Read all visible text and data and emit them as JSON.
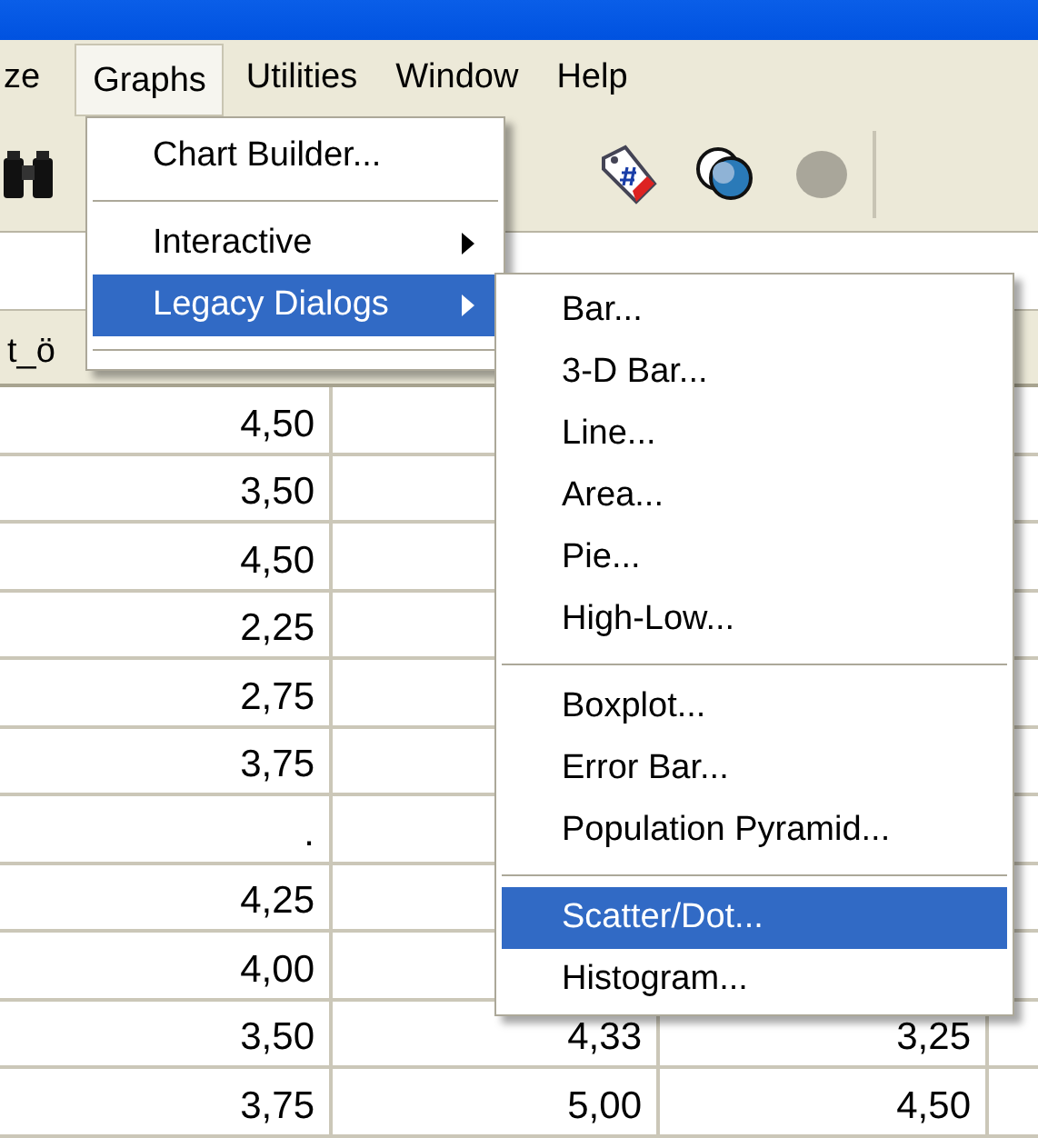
{
  "menubar": [
    {
      "label": "ze",
      "selected": false
    },
    {
      "label": "Graphs",
      "selected": true
    },
    {
      "label": "Utilities",
      "selected": false
    },
    {
      "label": "Window",
      "selected": false
    },
    {
      "label": "Help",
      "selected": false
    }
  ],
  "table": {
    "header": "t_ö",
    "rows": [
      {
        "cells": [
          "4,50"
        ]
      },
      {
        "cells": [
          "3,50"
        ]
      },
      {
        "cells": [
          "4,50"
        ]
      },
      {
        "cells": [
          "2,25"
        ]
      },
      {
        "cells": [
          "2,75"
        ]
      },
      {
        "cells": [
          "3,75"
        ]
      },
      {
        "cells": [
          "."
        ]
      },
      {
        "cells": [
          "4,25"
        ]
      },
      {
        "cells": [
          "4,00"
        ]
      },
      {
        "cells": [
          "3,50",
          "4,33",
          "3,25"
        ]
      },
      {
        "cells": [
          "3,75",
          "5,00",
          "4,50"
        ]
      }
    ]
  },
  "graphs_menu": [
    {
      "kind": "item",
      "label": "Chart Builder...",
      "selected": false,
      "submenu": false
    },
    {
      "kind": "separator"
    },
    {
      "kind": "item",
      "label": "Interactive",
      "selected": false,
      "submenu": true
    },
    {
      "kind": "item",
      "label": "Legacy Dialogs",
      "selected": true,
      "submenu": true
    },
    {
      "kind": "separator"
    }
  ],
  "legacy_dialogs_menu": [
    {
      "kind": "item",
      "label": "Bar...",
      "selected": false
    },
    {
      "kind": "item",
      "label": "3-D Bar...",
      "selected": false
    },
    {
      "kind": "item",
      "label": "Line...",
      "selected": false
    },
    {
      "kind": "item",
      "label": "Area...",
      "selected": false
    },
    {
      "kind": "item",
      "label": "Pie...",
      "selected": false
    },
    {
      "kind": "item",
      "label": "High-Low...",
      "selected": false
    },
    {
      "kind": "separator"
    },
    {
      "kind": "item",
      "label": "Boxplot...",
      "selected": false
    },
    {
      "kind": "item",
      "label": "Error Bar...",
      "selected": false
    },
    {
      "kind": "item",
      "label": "Population Pyramid...",
      "selected": false
    },
    {
      "kind": "separator"
    },
    {
      "kind": "item",
      "label": "Scatter/Dot...",
      "selected": true
    },
    {
      "kind": "item",
      "label": "Histogram...",
      "selected": false
    }
  ]
}
